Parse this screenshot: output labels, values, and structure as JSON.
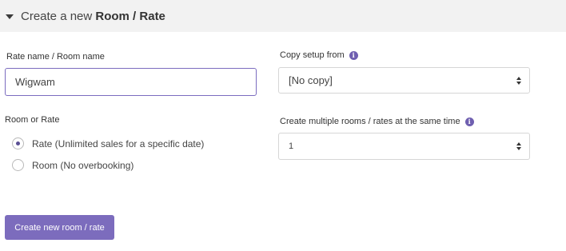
{
  "section": {
    "title_prefix": "Create a new ",
    "title_bold": "Room / Rate"
  },
  "rate_name": {
    "label": "Rate name / Room name",
    "value": "Wigwam"
  },
  "copy_setup": {
    "label": "Copy setup from",
    "selected": "[No copy]"
  },
  "room_or_rate": {
    "label": "Room or Rate",
    "options": [
      {
        "label": "Rate (Unlimited sales for a specific date)",
        "checked": true
      },
      {
        "label": "Room (No overbooking)",
        "checked": false
      }
    ]
  },
  "multiple": {
    "label": "Create multiple rooms / rates at the same time",
    "selected": "1"
  },
  "submit": {
    "label": "Create new room / rate"
  },
  "colors": {
    "accent": "#7c6cbd",
    "header_bg": "#f2f2f2"
  }
}
